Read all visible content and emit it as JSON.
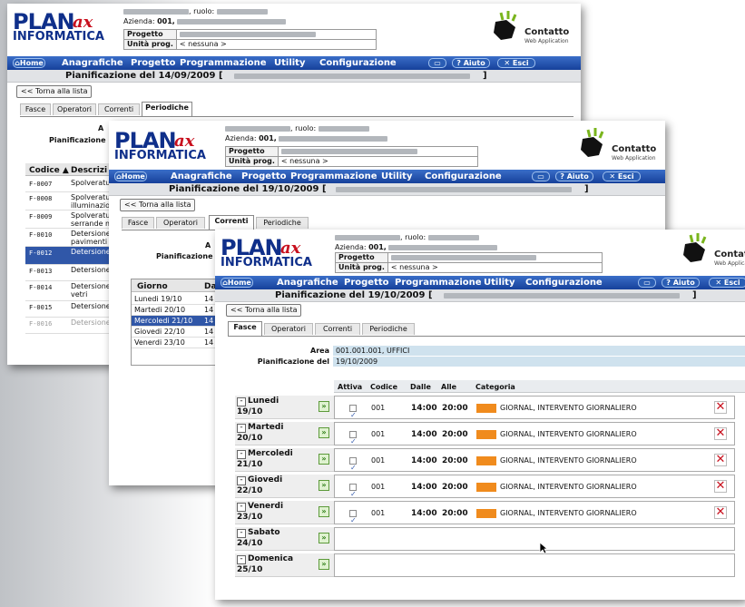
{
  "logo": {
    "line1": "PLAN",
    "line2": "INFORMATICA",
    "script": "ax"
  },
  "header": {
    "ruolo_label": ", ruolo:",
    "azienda_label": "Azienda:",
    "azienda_code": "001,",
    "progetto_label": "Progetto",
    "unita_label": "Unità prog.",
    "unita_value": "< nessuna >"
  },
  "contatto": {
    "title": "Contatto",
    "subtitle": "Web Application"
  },
  "menu": {
    "home": "Home",
    "items": [
      "Anagrafiche",
      "Progetto",
      "Programmazione",
      "Utility",
      "Configurazione"
    ],
    "aiuto": "Aiuto",
    "esci": "Esci"
  },
  "back_button": "<< Torna alla lista",
  "tabs": [
    "Fasce",
    "Operatori",
    "Correnti",
    "Periodiche"
  ],
  "win1": {
    "title": "Pianificazione del 14/09/2009 [",
    "title_end": "]",
    "area_label": "A",
    "pian_label": "Pianificazione",
    "grid_headers": [
      "Codice",
      "Descrizi"
    ],
    "rows": [
      {
        "code": "F-0007",
        "desc": "Spolveratu"
      },
      {
        "code": "F-0008",
        "desc": "Spolveratu illuminazion"
      },
      {
        "code": "F-0009",
        "desc": "Spolveratu serrande m"
      },
      {
        "code": "F-0010",
        "desc": "Detersione pavimenti"
      },
      {
        "code": "F-0012",
        "desc": "Detersione"
      },
      {
        "code": "F-0013",
        "desc": "Detersione"
      },
      {
        "code": "F-0014",
        "desc": "Detersione vetri"
      },
      {
        "code": "F-0015",
        "desc": "Detersione"
      },
      {
        "code": "F-0016",
        "desc": "Detersione"
      }
    ]
  },
  "win2": {
    "title": "Pianificazione del 19/10/2009 [",
    "title_end": "]",
    "area_label": "A",
    "pian_label": "Pianificazione",
    "grid_headers": [
      "Giorno",
      "Da"
    ],
    "days": [
      {
        "name": "Lunedi 19/10",
        "d": "14"
      },
      {
        "name": "Martedi 20/10",
        "d": "14"
      },
      {
        "name": "Mercoledi 21/10",
        "d": "14"
      },
      {
        "name": "Giovedi 22/10",
        "d": "14"
      },
      {
        "name": "Venerdi 23/10",
        "d": "14"
      }
    ]
  },
  "win3": {
    "title": "Pianificazione del 19/10/2009 [",
    "title_end": "]",
    "area_label": "Area",
    "area_value": "001.001.001, UFFICI",
    "pian_label": "Pianificazione del",
    "pian_value": "19/10/2009",
    "col_headers": {
      "attiva": "Attiva",
      "codice": "Codice",
      "dalle": "Dalle",
      "alle": "Alle",
      "categoria": "Categoria"
    },
    "category_color": "#f08b1d",
    "days": [
      {
        "name": "Lunedi",
        "date": "19/10",
        "has_slot": true,
        "codice": "001",
        "dalle": "14:00",
        "alle": "20:00",
        "categoria": "GIORNAL, INTERVENTO GIORNALIERO"
      },
      {
        "name": "Martedi",
        "date": "20/10",
        "has_slot": true,
        "codice": "001",
        "dalle": "14:00",
        "alle": "20:00",
        "categoria": "GIORNAL, INTERVENTO GIORNALIERO"
      },
      {
        "name": "Mercoledi",
        "date": "21/10",
        "has_slot": true,
        "codice": "001",
        "dalle": "14:00",
        "alle": "20:00",
        "categoria": "GIORNAL, INTERVENTO GIORNALIERO"
      },
      {
        "name": "Giovedi",
        "date": "22/10",
        "has_slot": true,
        "codice": "001",
        "dalle": "14:00",
        "alle": "20:00",
        "categoria": "GIORNAL, INTERVENTO GIORNALIERO"
      },
      {
        "name": "Venerdi",
        "date": "23/10",
        "has_slot": true,
        "codice": "001",
        "dalle": "14:00",
        "alle": "20:00",
        "categoria": "GIORNAL, INTERVENTO GIORNALIERO"
      },
      {
        "name": "Sabato",
        "date": "24/10",
        "has_slot": false
      },
      {
        "name": "Domenica",
        "date": "25/10",
        "has_slot": false
      }
    ]
  }
}
